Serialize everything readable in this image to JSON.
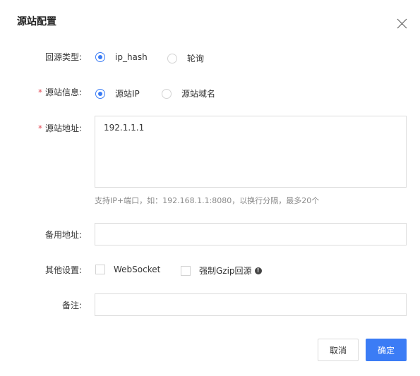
{
  "dialog": {
    "title": "源站配置"
  },
  "form": {
    "backsource": {
      "label": "回源类型:",
      "options": [
        "ip_hash",
        "轮询"
      ],
      "selected": "ip_hash"
    },
    "origin_info": {
      "required_mark": "*",
      "label": "源站信息:",
      "options": [
        "源站IP",
        "源站域名"
      ],
      "selected": "源站IP"
    },
    "origin_address": {
      "required_mark": "*",
      "label": "源站地址:",
      "value": "192.1.1.1",
      "hint": "支持IP+端口，如：192.168.1.1:8080，以换行分隔，最多20个"
    },
    "backup_address": {
      "label": "备用地址:",
      "value": ""
    },
    "other_settings": {
      "label": "其他设置:",
      "options": [
        "WebSocket",
        "强制Gzip回源"
      ],
      "info_icon": "!"
    },
    "remark": {
      "label": "备注:",
      "value": ""
    }
  },
  "footer": {
    "cancel_label": "取消",
    "ok_label": "确定"
  },
  "colors": {
    "primary": "#3b7cf5",
    "required": "#e34d59"
  }
}
